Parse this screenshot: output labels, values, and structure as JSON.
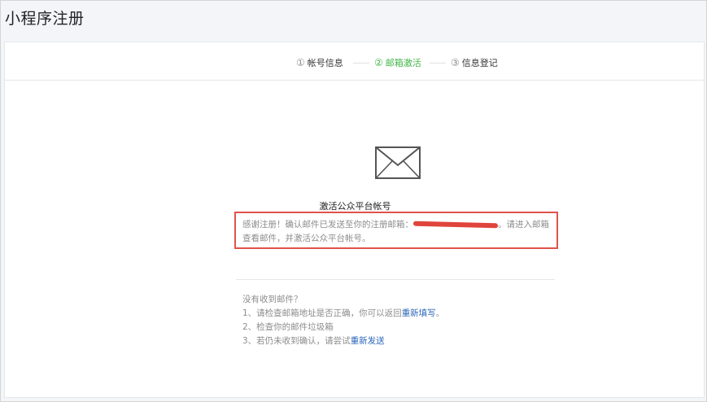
{
  "page": {
    "title": "小程序注册"
  },
  "steps": [
    {
      "num": "①",
      "label": "帐号信息",
      "active": false
    },
    {
      "num": "②",
      "label": "邮箱激活",
      "active": true
    },
    {
      "num": "③",
      "label": "信息登记",
      "active": false
    }
  ],
  "activation": {
    "icon": "envelope-icon",
    "headline": "激活公众平台帐号",
    "notice_prefix": "感谢注册！确认邮件已发送至你的注册邮箱：",
    "notice_suffix": "。请进入邮箱查看邮件，并激活公众平台帐号。"
  },
  "help": {
    "title": "没有收到邮件？",
    "item1_prefix": "1、请检查邮箱地址是否正确，你可以返回",
    "item1_link": "重新填写",
    "item1_suffix": "。",
    "item2": "2、检查你的邮件垃圾箱",
    "item3_prefix": "3、若仍未收到确认，请尝试",
    "item3_link": "重新发送"
  },
  "colors": {
    "active_step": "#44b549",
    "highlight_border": "#e0534a",
    "link": "#2b66b8"
  }
}
